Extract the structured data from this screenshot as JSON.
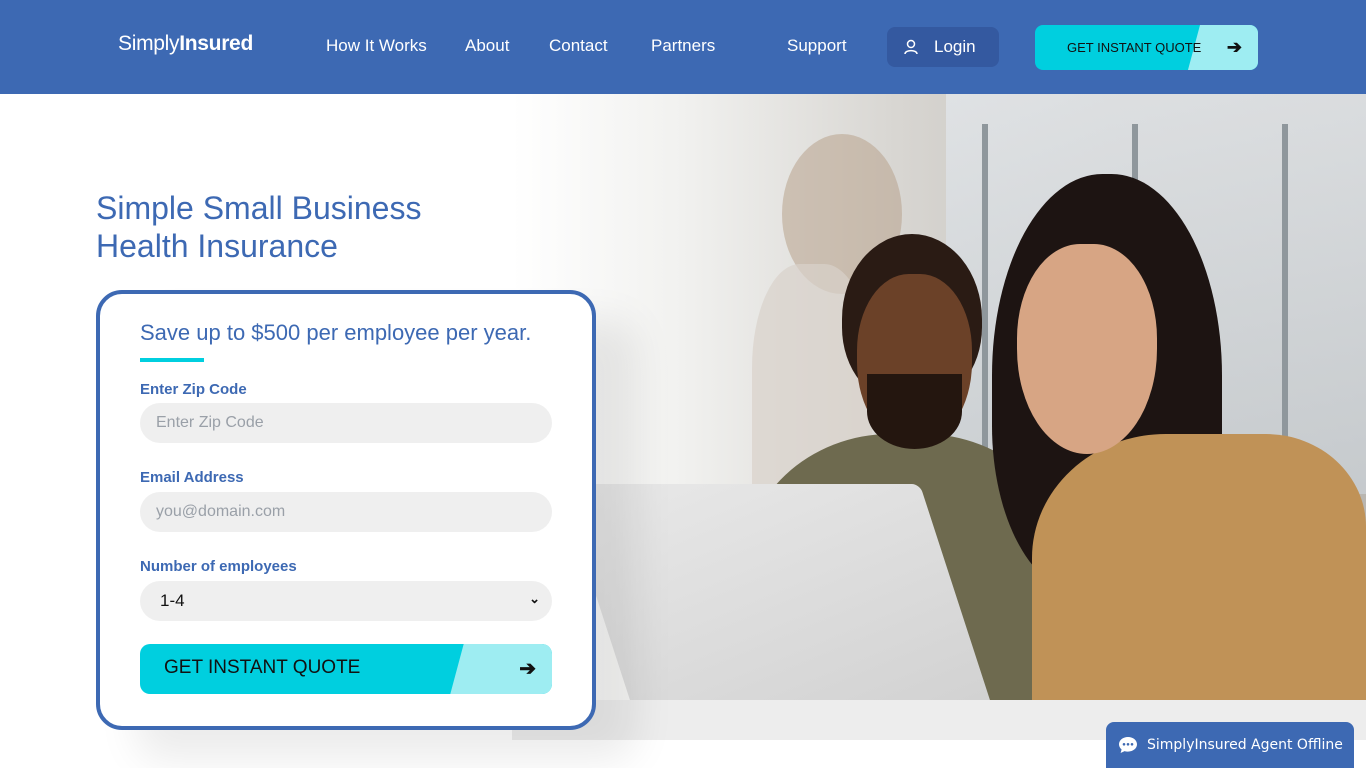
{
  "brand": {
    "name_light": "Simply",
    "name_bold": "Insured"
  },
  "nav": {
    "links": [
      "How It Works",
      "About",
      "Contact",
      "Partners",
      "Support"
    ],
    "login_label": "Login",
    "quote_label": "GET INSTANT QUOTE"
  },
  "hero": {
    "headline_line1": "Simple Small Business",
    "headline_line2": "Health Insurance"
  },
  "form": {
    "title": "Save up to $500 per employee per year.",
    "zip_label": "Enter Zip Code",
    "zip_placeholder": "Enter Zip Code",
    "email_label": "Email Address",
    "email_placeholder": "you@domain.com",
    "employees_label": "Number of employees",
    "employees_selected": "1-4",
    "submit_label": "GET INSTANT QUOTE",
    "arrow": "➔"
  },
  "chat": {
    "label": "SimplyInsured Agent Offline"
  },
  "colors": {
    "brand_blue": "#3d69b3",
    "accent_cyan": "#00cfdf",
    "accent_light": "#9eedf2"
  },
  "icons": {
    "arrow": "arrow-right-icon",
    "user": "user-icon",
    "chat": "chat-bubble-icon",
    "chevron": "chevron-down-icon"
  }
}
